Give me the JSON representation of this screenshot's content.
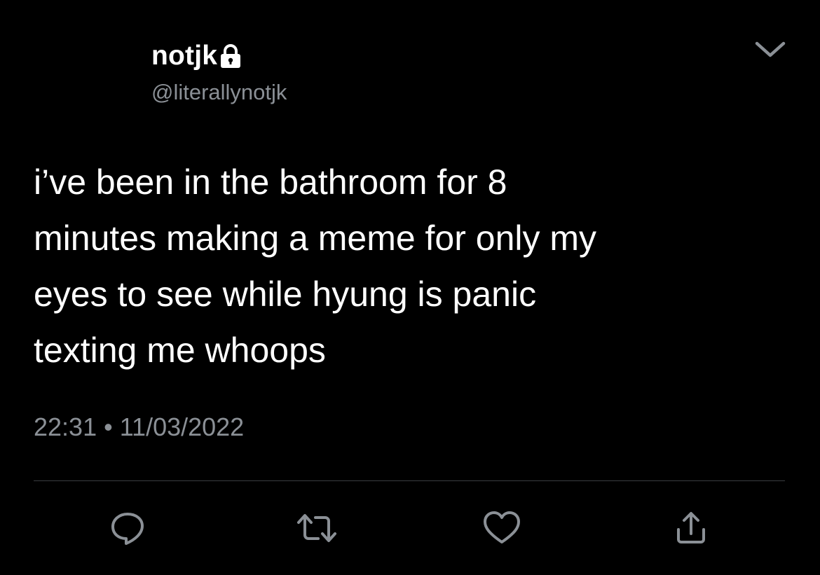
{
  "author": {
    "display_name": "notjk",
    "handle": "@literallynotjk",
    "protected_icon": "lock-icon"
  },
  "menu_icon": "chevron-down-icon",
  "tweet": {
    "text": "i’ve been in the bathroom for 8\nminutes making a meme for only my\neyes to see while hyung is panic\ntexting me whoops",
    "time": "22:31",
    "separator": "•",
    "date": "11/03/2022"
  },
  "actions": [
    {
      "name": "reply",
      "icon": "reply-icon"
    },
    {
      "name": "retweet",
      "icon": "retweet-icon"
    },
    {
      "name": "like",
      "icon": "heart-icon"
    },
    {
      "name": "share",
      "icon": "share-icon"
    }
  ],
  "colors": {
    "background": "#000000",
    "text": "#ffffff",
    "secondary_text": "#8b9096",
    "icon": "#8b9096",
    "divider": "#3a3d41"
  }
}
